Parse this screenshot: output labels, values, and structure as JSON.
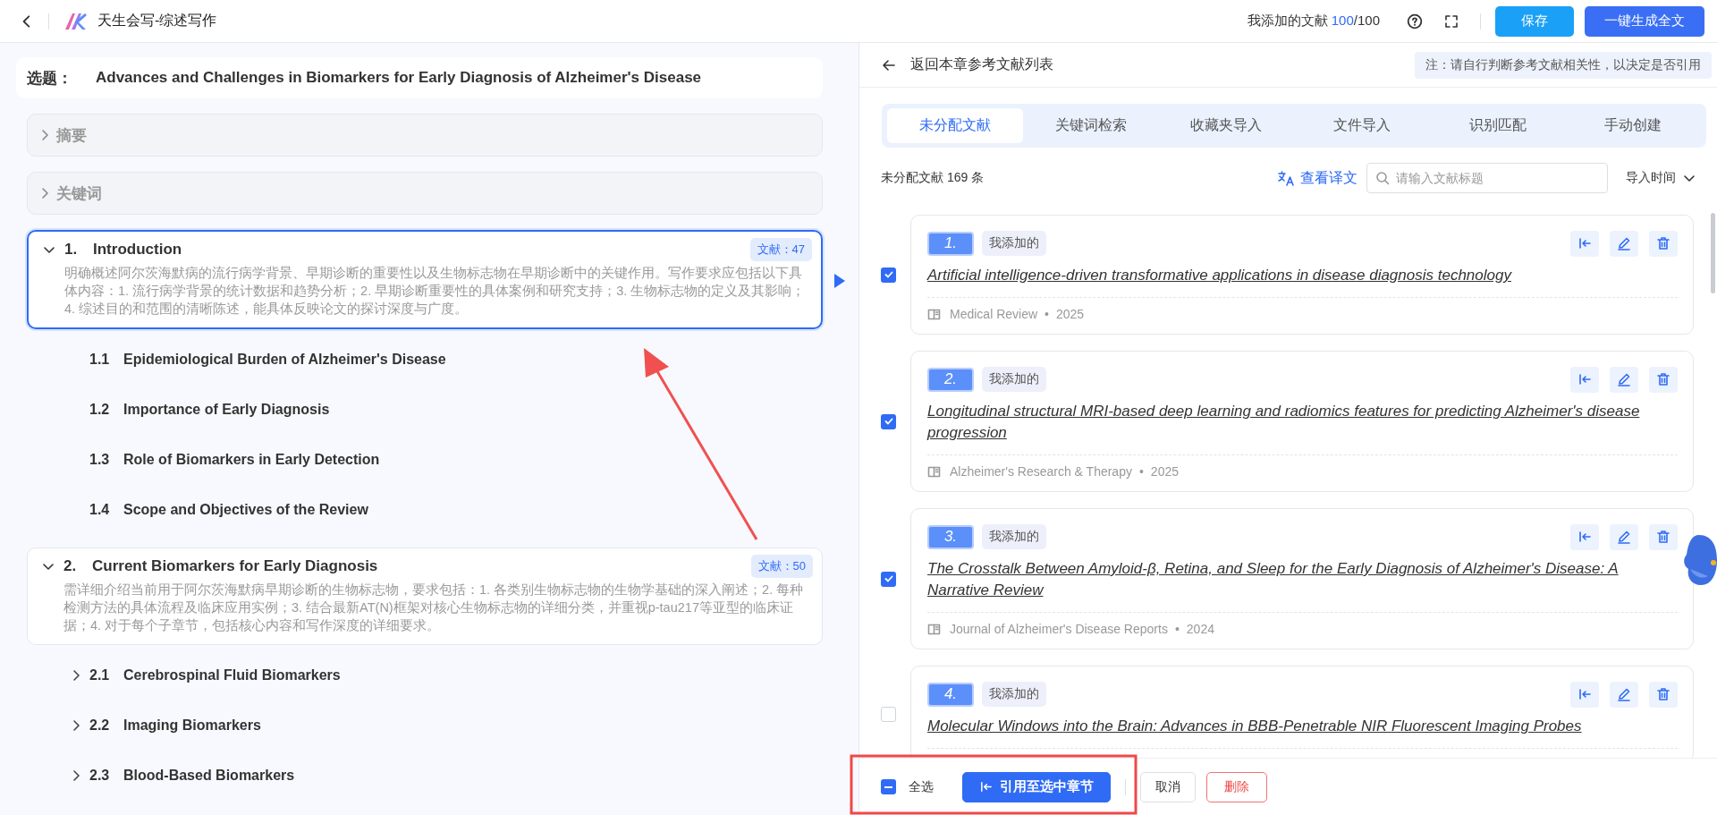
{
  "app": {
    "title": "天生会写-综述写作",
    "quota_label": "我添加的文献",
    "quota_used": "100",
    "quota_total": "/100",
    "buttons": [
      {
        "label": "保存",
        "kind": "secondary"
      },
      {
        "label": "一键生成全文",
        "kind": "primary"
      }
    ]
  },
  "topic": {
    "label": "选题：",
    "title": "Advances and Challenges in Biomarkers for Early Diagnosis of Alzheimer's Disease"
  },
  "outline": [
    {
      "kind": "section",
      "title": "摘要",
      "expanded": false
    },
    {
      "kind": "section",
      "title": "关键词",
      "expanded": false
    },
    {
      "kind": "chapter",
      "number": "1.",
      "title": "Introduction",
      "badge": "文献：47",
      "expanded": true,
      "selected": true,
      "description": "明确概述阿尔茨海默病的流行病学背景、早期诊断的重要性以及生物标志物在早期诊断中的关键作用。写作要求应包括以下具体内容：1. 流行病学背景的统计数据和趋势分析；2. 早期诊断重要性的具体案例和研究支持；3. 生物标志物的定义及其影响；4. 综述目的和范围的清晰陈述，能具体反映论文的探讨深度与广度。",
      "children": [
        {
          "number": "1.1",
          "title": "Epidemiological Burden of Alzheimer's Disease",
          "expandable": false
        },
        {
          "number": "1.2",
          "title": "Importance of Early Diagnosis",
          "expandable": false
        },
        {
          "number": "1.3",
          "title": "Role of Biomarkers in Early Detection",
          "expandable": false
        },
        {
          "number": "1.4",
          "title": "Scope and Objectives of the Review",
          "expandable": false
        }
      ]
    },
    {
      "kind": "chapter",
      "number": "2.",
      "title": "Current Biomarkers for Early Diagnosis",
      "badge": "文献：50",
      "expanded": true,
      "selected": false,
      "description": "需详细介绍当前用于阿尔茨海默病早期诊断的生物标志物，要求包括：1. 各类别生物标志物的生物学基础的深入阐述；2. 每种检测方法的具体流程及临床应用实例；3. 结合最新AT(N)框架对核心生物标志物的详细分类，并重视p-tau217等亚型的临床证据；4. 对于每个子章节，包括核心内容和写作深度的详细要求。",
      "children": [
        {
          "number": "2.1",
          "title": "Cerebrospinal Fluid Biomarkers",
          "expandable": true
        },
        {
          "number": "2.2",
          "title": "Imaging Biomarkers",
          "expandable": true
        },
        {
          "number": "2.3",
          "title": "Blood-Based Biomarkers",
          "expandable": true
        }
      ]
    }
  ],
  "references": {
    "back_label": "返回本章参考文献列表",
    "note": "注：请自行判断参考文献相关性，以决定是否引用",
    "tabs": [
      {
        "label": "未分配文献",
        "selected": true
      },
      {
        "label": "关键词检索",
        "selected": false
      },
      {
        "label": "收藏夹导入",
        "selected": false
      },
      {
        "label": "文件导入",
        "selected": false
      },
      {
        "label": "识别匹配",
        "selected": false
      },
      {
        "label": "手动创建",
        "selected": false
      }
    ],
    "count_label": "未分配文献 169 条",
    "translate_label": "查看译文",
    "search": {
      "placeholder": "请输入文献标题"
    },
    "sort_label": "导入时间",
    "items": [
      {
        "number": "1.",
        "tag": "我添加的",
        "title": "Artificial intelligence-driven transformative applications in disease diagnosis technology",
        "journal": "Medical Review",
        "separator": "•",
        "year": "2025",
        "checked": true
      },
      {
        "number": "2.",
        "tag": "我添加的",
        "title": "Longitudinal structural MRI-based deep learning and radiomics features for predicting Alzheimer's disease progression",
        "journal": "Alzheimer's Research & Therapy",
        "separator": "•",
        "year": "2025",
        "checked": true
      },
      {
        "number": "3.",
        "tag": "我添加的",
        "title": "The Crosstalk Between Amyloid-β, Retina, and Sleep for the Early Diagnosis of Alzheimer's Disease: A Narrative Review",
        "journal": "Journal of Alzheimer's Disease Reports",
        "separator": "•",
        "year": "2024",
        "checked": true
      },
      {
        "number": "4.",
        "tag": "我添加的",
        "title": "Molecular Windows into the Brain: Advances in BBB-Penetrable NIR Fluorescent Imaging Probes",
        "checked": false
      }
    ],
    "footer": {
      "select_all": {
        "label": "全选",
        "indeterminate": true
      },
      "buttons": [
        {
          "label": "引用至选中章节",
          "kind": "primary"
        },
        {
          "label": "取消",
          "kind": "default"
        },
        {
          "label": "删除",
          "kind": "danger"
        }
      ]
    }
  }
}
